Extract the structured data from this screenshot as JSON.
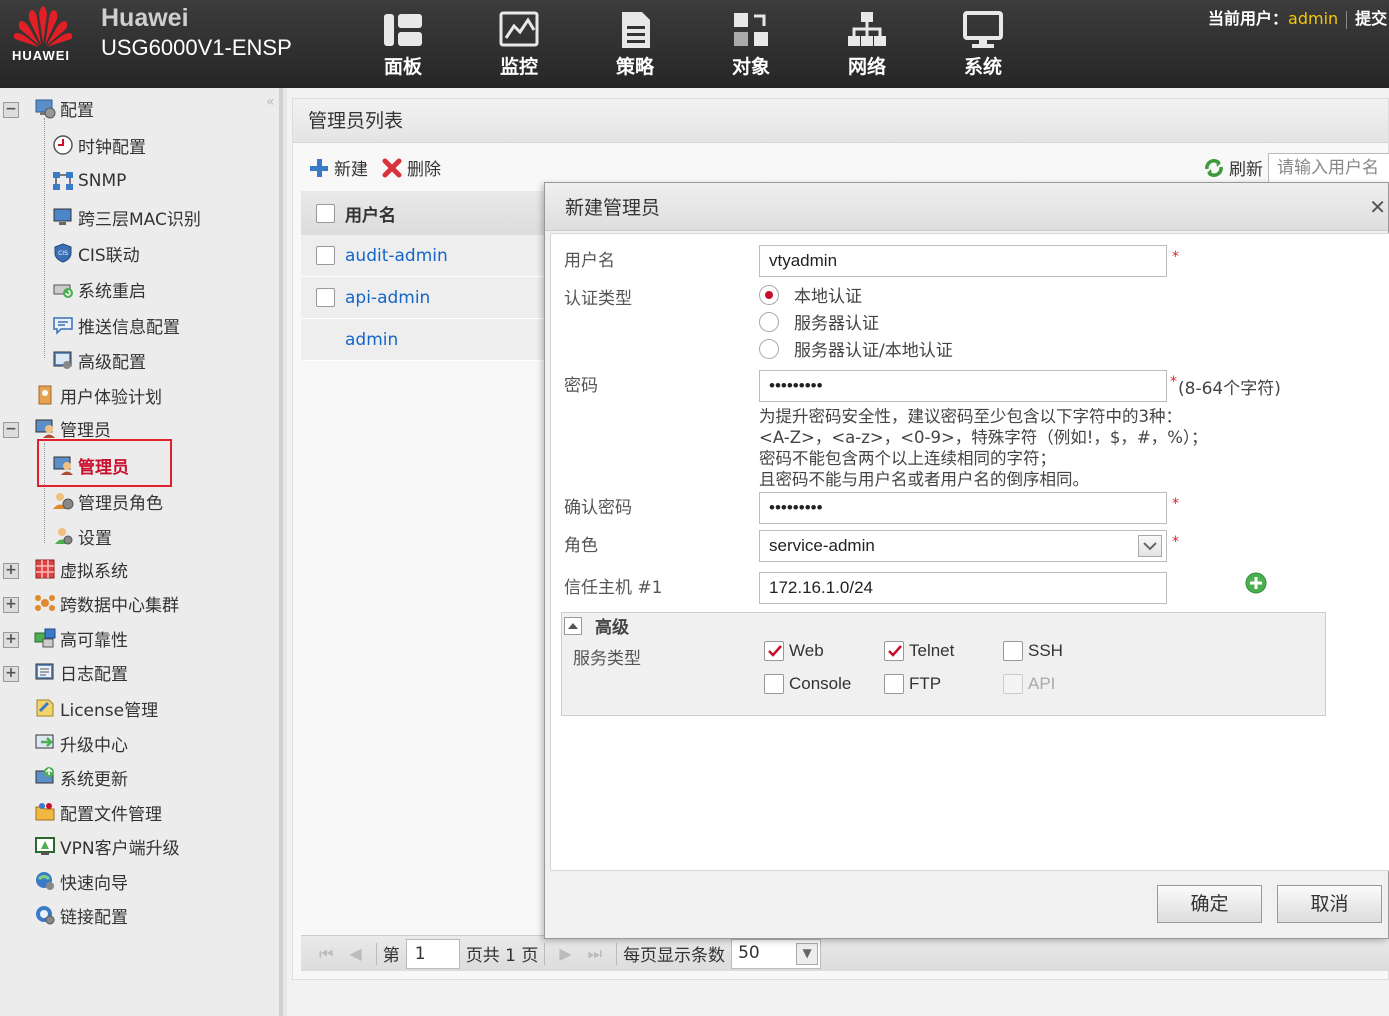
{
  "header": {
    "brand": "Huawei",
    "model": "USG6000V1-ENSP",
    "logo_text": "HUAWEI",
    "nav": [
      {
        "label": "面板",
        "icon": "dashboard-icon"
      },
      {
        "label": "监控",
        "icon": "monitor-icon"
      },
      {
        "label": "策略",
        "icon": "policy-icon"
      },
      {
        "label": "对象",
        "icon": "object-icon"
      },
      {
        "label": "网络",
        "icon": "network-icon"
      },
      {
        "label": "系统",
        "icon": "system-icon"
      }
    ],
    "current_user_label": "当前用户：",
    "current_user": "admin",
    "submit": "提交"
  },
  "sidebar": {
    "items": [
      {
        "label": "配置"
      },
      {
        "label": "时钟配置"
      },
      {
        "label": "SNMP"
      },
      {
        "label": "跨三层MAC识别"
      },
      {
        "label": "CIS联动"
      },
      {
        "label": "系统重启"
      },
      {
        "label": "推送信息配置"
      },
      {
        "label": "高级配置"
      },
      {
        "label": "用户体验计划"
      },
      {
        "label": "管理员"
      },
      {
        "label": "管理员"
      },
      {
        "label": "管理员角色"
      },
      {
        "label": "设置"
      },
      {
        "label": "虚拟系统"
      },
      {
        "label": "跨数据中心集群"
      },
      {
        "label": "高可靠性"
      },
      {
        "label": "日志配置"
      },
      {
        "label": "License管理"
      },
      {
        "label": "升级中心"
      },
      {
        "label": "系统更新"
      },
      {
        "label": "配置文件管理"
      },
      {
        "label": "VPN客户端升级"
      },
      {
        "label": "快速向导"
      },
      {
        "label": "链接配置"
      }
    ]
  },
  "main": {
    "title": "管理员列表",
    "new_label": "新建",
    "delete_label": "删除",
    "refresh_label": "刷新",
    "search_placeholder": "请输入用户名",
    "column_username": "用户名",
    "rows": [
      "audit-admin",
      "api-admin",
      "admin"
    ],
    "pager": {
      "page_prefix": "第",
      "page": "1",
      "page_suffix": "页共 1 页",
      "per_page_label": "每页显示条数",
      "per_page": "50"
    }
  },
  "dialog": {
    "title": "新建管理员",
    "username_label": "用户名",
    "username": "vtyadmin",
    "auth_type_label": "认证类型",
    "auth_options": [
      "本地认证",
      "服务器认证",
      "服务器认证/本地认证"
    ],
    "auth_selected": "本地认证",
    "password_label": "密码",
    "password_mask": "•••••••••",
    "password_note": "(8-64个字符)",
    "password_hint": [
      "为提升密码安全性，建议密码至少包含以下字符中的3种：",
      "<A-Z>，<a-z>，<0-9>，特殊字符（例如!，$，#，%）；",
      "密码不能包含两个以上连续相同的字符；",
      "且密码不能与用户名或者用户名的倒序相同。"
    ],
    "confirm_label": "确认密码",
    "confirm_mask": "•••••••••",
    "role_label": "角色",
    "role": "service-admin",
    "trusted_host_label": "信任主机 #1",
    "trusted_host": "172.16.1.0/24",
    "advanced_label": "高级",
    "service_type_label": "服务类型",
    "services": [
      {
        "label": "Web",
        "checked": true
      },
      {
        "label": "Telnet",
        "checked": true
      },
      {
        "label": "SSH",
        "checked": false
      },
      {
        "label": "Console",
        "checked": false
      },
      {
        "label": "FTP",
        "checked": false
      },
      {
        "label": "API",
        "checked": false
      }
    ],
    "ok": "确定",
    "cancel": "取消"
  },
  "colors": {
    "header_bg": "#2e2e2e",
    "accent_red": "#c8102e",
    "link_blue": "#1566c8",
    "user_yellow": "#f6c70a",
    "selection_box": "#e0202c"
  }
}
